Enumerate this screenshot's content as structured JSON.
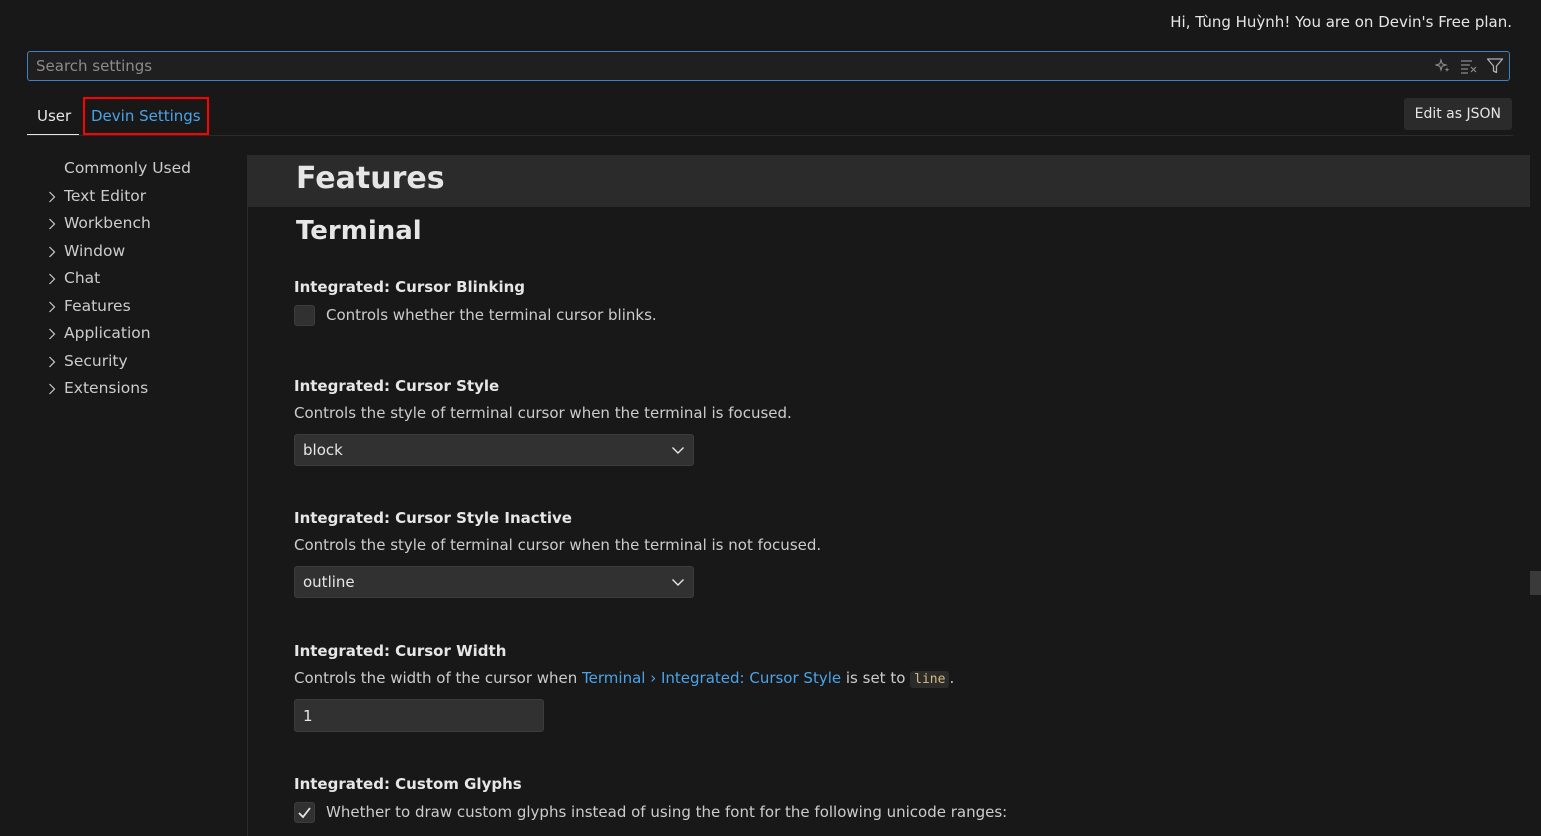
{
  "header": {
    "greeting": "Hi, Tùng Huỳnh! You are on Devin's Free plan."
  },
  "search": {
    "placeholder": "Search settings",
    "icons": [
      "sparkle-icon",
      "clear-filter-icon",
      "filter-icon"
    ]
  },
  "tabs": [
    {
      "label": "User"
    },
    {
      "label": "Devin Settings"
    }
  ],
  "toolbar": {
    "edit_json_label": "Edit as JSON"
  },
  "toc": [
    {
      "label": "Commonly Used",
      "expandable": false
    },
    {
      "label": "Text Editor",
      "expandable": true
    },
    {
      "label": "Workbench",
      "expandable": true
    },
    {
      "label": "Window",
      "expandable": true
    },
    {
      "label": "Chat",
      "expandable": true
    },
    {
      "label": "Features",
      "expandable": true
    },
    {
      "label": "Application",
      "expandable": true
    },
    {
      "label": "Security",
      "expandable": true
    },
    {
      "label": "Extensions",
      "expandable": true
    }
  ],
  "main": {
    "section_title": "Features",
    "subsection_title": "Terminal",
    "settings": {
      "cursor_blinking": {
        "prefix": "Integrated: ",
        "name": "Cursor Blinking",
        "description": "Controls whether the terminal cursor blinks.",
        "checked": false
      },
      "cursor_style": {
        "prefix": "Integrated: ",
        "name": "Cursor Style",
        "description": "Controls the style of terminal cursor when the terminal is focused.",
        "value": "block"
      },
      "cursor_style_inactive": {
        "prefix": "Integrated: ",
        "name": "Cursor Style Inactive",
        "description": "Controls the style of terminal cursor when the terminal is not focused.",
        "value": "outline"
      },
      "cursor_width": {
        "prefix": "Integrated: ",
        "name": "Cursor Width",
        "desc_before": "Controls the width of the cursor when ",
        "desc_link": "Terminal › Integrated: Cursor Style",
        "desc_middle": " is set to ",
        "desc_code": "line",
        "desc_after": ".",
        "value": "1"
      },
      "custom_glyphs": {
        "prefix": "Integrated: ",
        "name": "Custom Glyphs",
        "description": "Whether to draw custom glyphs instead of using the font for the following unicode ranges:",
        "checked": true
      }
    }
  },
  "colors": {
    "background": "#181818",
    "accent": "#4aa3e8",
    "highlight_box": "#ff0000"
  }
}
